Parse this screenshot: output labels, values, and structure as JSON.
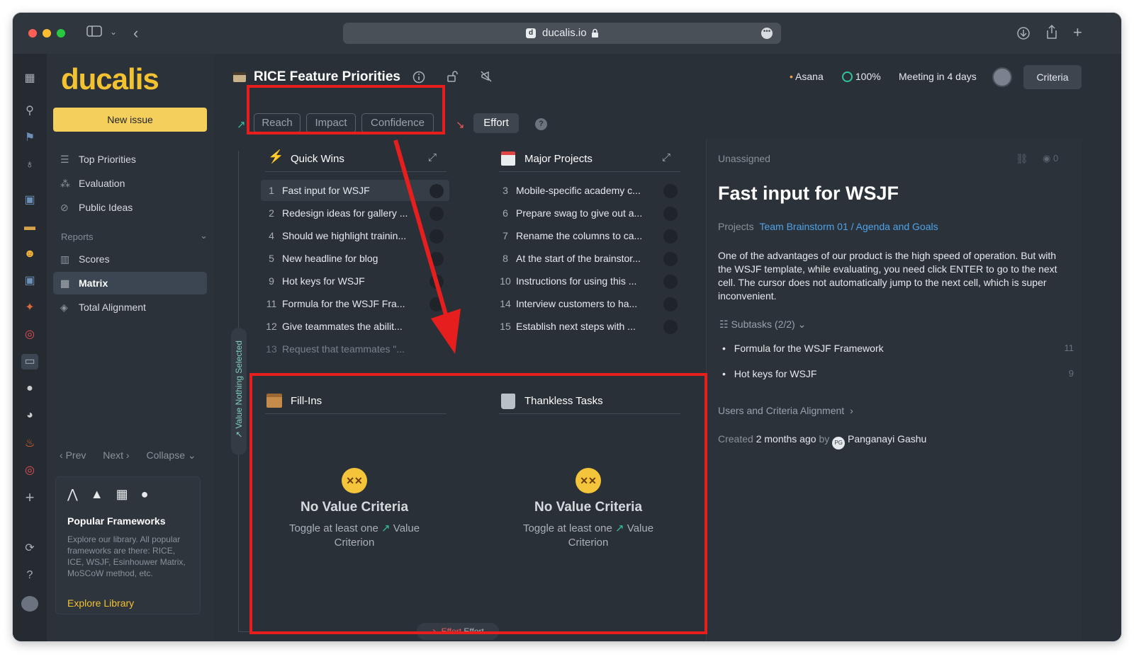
{
  "browser": {
    "url": "ducalis.io"
  },
  "sidebar": {
    "logo": "ducalis",
    "new_issue": "New issue",
    "nav": [
      {
        "label": "Top Priorities"
      },
      {
        "label": "Evaluation"
      },
      {
        "label": "Public Ideas"
      }
    ],
    "reports_label": "Reports",
    "reports": [
      {
        "label": "Scores"
      },
      {
        "label": "Matrix"
      },
      {
        "label": "Total Alignment"
      }
    ],
    "pager": {
      "prev": "Prev",
      "next": "Next",
      "collapse": "Collapse"
    },
    "card": {
      "title": "Popular Frameworks",
      "text": "Explore our library. All popular frameworks are there: RICE, ICE, WSJF, Esinhouwer Matrix, MoSCoW method, etc.",
      "link": "Explore Library"
    }
  },
  "header": {
    "title": "RICE Feature Priorities",
    "integration": "Asana",
    "progress": "100%",
    "meeting": "Meeting in 4 days",
    "criteria_button": "Criteria"
  },
  "criteria": {
    "value": [
      "Reach",
      "Impact",
      "Confidence"
    ],
    "effort": "Effort",
    "help": "?"
  },
  "matrix": {
    "value_axis": "Value Nothing Selected",
    "effort_axis": "Effort",
    "effort_axis_label": "Effort",
    "quadrants": {
      "quick_wins": {
        "title": "Quick Wins",
        "items": [
          {
            "num": "1",
            "label": "Fast input for WSJF"
          },
          {
            "num": "2",
            "label": "Redesign ideas for gallery ..."
          },
          {
            "num": "4",
            "label": "Should we highlight trainin..."
          },
          {
            "num": "5",
            "label": "New headline for blog"
          },
          {
            "num": "9",
            "label": "Hot keys for WSJF"
          },
          {
            "num": "11",
            "label": "Formula for the WSJF Fra..."
          },
          {
            "num": "12",
            "label": "Give teammates the abilit..."
          },
          {
            "num": "13",
            "label": "Request that teammates \"..."
          }
        ]
      },
      "major_projects": {
        "title": "Major Projects",
        "items": [
          {
            "num": "3",
            "label": "Mobile-specific academy c..."
          },
          {
            "num": "6",
            "label": "Prepare swag to give out a..."
          },
          {
            "num": "7",
            "label": "Rename the columns to ca..."
          },
          {
            "num": "8",
            "label": "At the start of the brainstor..."
          },
          {
            "num": "10",
            "label": "Instructions for using this ..."
          },
          {
            "num": "14",
            "label": "Interview customers to ha..."
          },
          {
            "num": "15",
            "label": "Establish next steps with ..."
          }
        ]
      },
      "fill_ins": {
        "title": "Fill-Ins",
        "empty_title": "No Value Criteria",
        "empty_text_1": "Toggle at least one",
        "empty_text_2": "Value",
        "empty_text_3": "Criterion"
      },
      "thankless_tasks": {
        "title": "Thankless Tasks",
        "empty_title": "No Value Criteria",
        "empty_text_1": "Toggle at least one",
        "empty_text_2": "Value",
        "empty_text_3": "Criterion"
      }
    }
  },
  "detail": {
    "assignee": "Unassigned",
    "views": "0",
    "title": "Fast input for WSJF",
    "projects_label": "Projects",
    "projects_value": "Team Brainstorm 01 / Agenda and Goals",
    "description": "One of the advantages of our product is the high speed of operation. But with the WSJF template, while evaluating, you need click ENTER to go to the next cell. The cursor does not automatically jump to the next cell, which is super inconvenient.",
    "subtasks_label": "Subtasks (2/2)",
    "subtasks": [
      {
        "label": "Formula for the WSJF Framework",
        "num": "11"
      },
      {
        "label": "Hot keys for WSJF",
        "num": "9"
      }
    ],
    "alignment_link": "Users and Criteria Alignment",
    "created_prefix": "Created",
    "created_when": "2 months ago",
    "created_by": "by",
    "author_initials": "PG",
    "author": "Panganayi Gashu"
  },
  "colors": {
    "accent_yellow": "#f3c230",
    "link_blue": "#4ea3e8",
    "annotation_red": "#e61e1e",
    "value_green": "#33c49b",
    "effort_red": "#f05a5a"
  }
}
